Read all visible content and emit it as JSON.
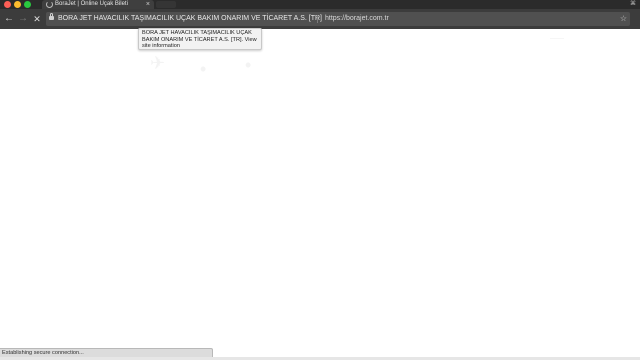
{
  "tab": {
    "title": "BoraJet | Online Uçak Bileti",
    "close_icon": "×"
  },
  "toolbar": {
    "back_icon": "←",
    "forward_icon": "→",
    "stop_icon": "✕",
    "ev_certificate_name": "BORA JET HAVACILIK TAŞIMACILIK UÇAK BAKIM ONARIM VE TİCARET A.S. [TR]",
    "url": "https://borajet.com.tr",
    "star_icon": "☆"
  },
  "tooltip": {
    "text": "BORA JET HAVACILIK TAŞIMACILIK UÇAK BAKIM ONARIM VE TİCARET A.S. [TR]. View site information"
  },
  "status": {
    "text": "Establishing secure connection..."
  },
  "colors": {
    "tabstrip": "#2b2b2b",
    "toolbar": "#3c3c3c",
    "omnibox": "#505050"
  }
}
